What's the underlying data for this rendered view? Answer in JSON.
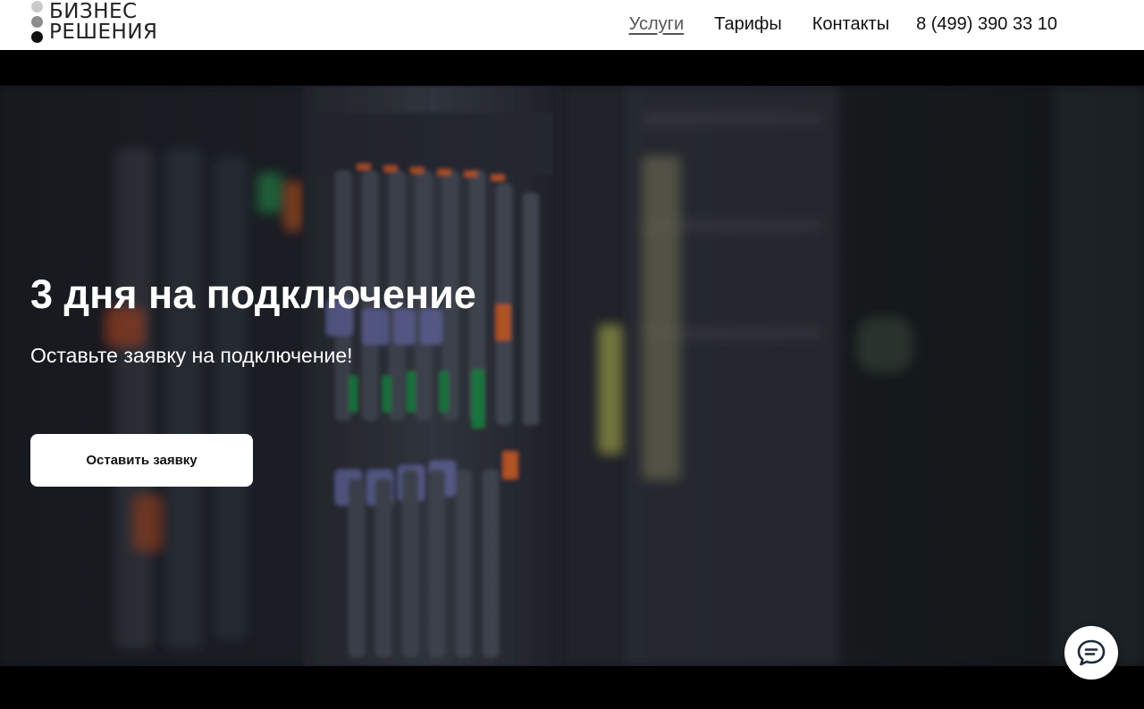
{
  "logo": {
    "line1": "БИЗНЕС",
    "line2": "РЕШЕНИЯ",
    "dots_colors": [
      "#c9c9c9",
      "#8d8d8d",
      "#111111"
    ]
  },
  "nav": {
    "items": [
      {
        "label": "Услуги",
        "active": true
      },
      {
        "label": "Тарифы",
        "active": false
      },
      {
        "label": "Контакты",
        "active": false
      }
    ],
    "phone": "8 (499) 390 33 10"
  },
  "hero": {
    "title": "3 дня на подключение",
    "subtitle": "Оставьте заявку на подключение!",
    "cta_label": "Оставить заявку",
    "background": "server-rack-photo"
  },
  "chat_widget": {
    "icon": "chat-bubble-icon"
  },
  "colors": {
    "header_bg": "#ffffff",
    "page_bg": "#000000",
    "text_on_hero": "#ffffff",
    "button_bg": "#ffffff"
  }
}
